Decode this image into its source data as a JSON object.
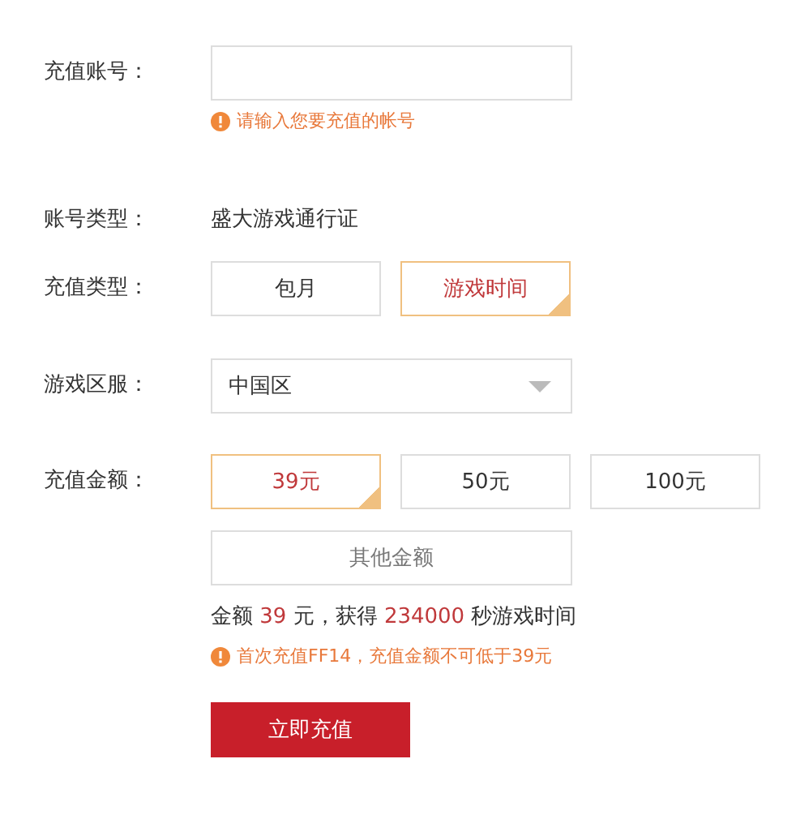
{
  "account": {
    "label": "充值账号：",
    "hint": "请输入您要充值的帐号"
  },
  "account_type": {
    "label": "账号类型：",
    "value": "盛大游戏通行证"
  },
  "recharge_type": {
    "label": "充值类型：",
    "options": [
      {
        "label": "包月",
        "selected": false
      },
      {
        "label": "游戏时间",
        "selected": true
      }
    ]
  },
  "server": {
    "label": "游戏区服：",
    "value": "中国区"
  },
  "amount": {
    "label": "充值金额：",
    "options": [
      {
        "label": "39元",
        "selected": true
      },
      {
        "label": "50元",
        "selected": false
      },
      {
        "label": "100元",
        "selected": false
      }
    ],
    "other": "其他金额"
  },
  "summary": [
    {
      "text": "金额 ",
      "highlight": false
    },
    {
      "text": "39",
      "highlight": true
    },
    {
      "text": " 元，获得 ",
      "highlight": false
    },
    {
      "text": "234000",
      "highlight": true
    },
    {
      "text": " 秒游戏时间",
      "highlight": false
    }
  ],
  "warning": "首次充值FF14，充值金额不可低于39元",
  "submit": "立即充值"
}
